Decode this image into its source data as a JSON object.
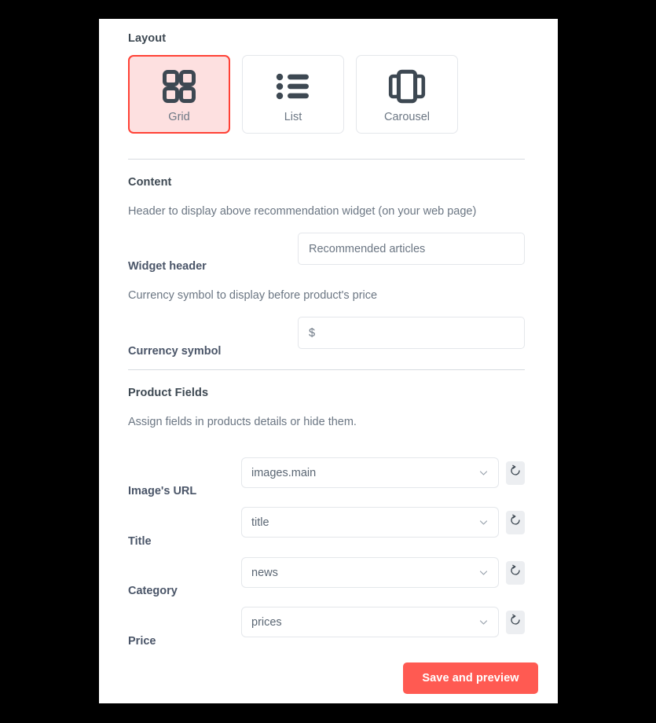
{
  "layout": {
    "section_title": "Layout",
    "options": [
      {
        "label": "Grid",
        "icon": "grid-icon",
        "selected": true
      },
      {
        "label": "List",
        "icon": "list-icon",
        "selected": false
      },
      {
        "label": "Carousel",
        "icon": "carousel-icon",
        "selected": false
      }
    ]
  },
  "content": {
    "section_title": "Content",
    "widget_header_help": "Header to display above recommendation widget (on your web page)",
    "widget_header_label": "Widget header",
    "widget_header_value": "Recommended articles",
    "widget_header_placeholder": "Recommended articles",
    "currency_help": "Currency symbol to display before product's price",
    "currency_label": "Currency symbol",
    "currency_value": "$",
    "currency_placeholder": "$"
  },
  "product_fields": {
    "section_title": "Product Fields",
    "description": "Assign fields in products details or hide them.",
    "rows": [
      {
        "label": "Image's URL",
        "value": "images.main",
        "reset_icon": "refresh-icon",
        "chevron_icon": "chevron-down-icon"
      },
      {
        "label": "Title",
        "value": "title",
        "reset_icon": "refresh-icon",
        "chevron_icon": "chevron-down-icon"
      },
      {
        "label": "Category",
        "value": "news",
        "reset_icon": "refresh-icon",
        "chevron_icon": "chevron-down-icon"
      },
      {
        "label": "Price",
        "value": "prices",
        "reset_icon": "refresh-icon",
        "chevron_icon": "chevron-down-icon"
      }
    ]
  },
  "footer": {
    "save_label": "Save and preview"
  },
  "colors": {
    "accent": "#ff5a52",
    "selected_border": "#ff4136",
    "selected_fill": "#fde0e0",
    "icon_dark": "#3d4852",
    "text_muted": "#6b7683",
    "border": "#e4e7eb",
    "divider": "#d7dbe0",
    "page_background": "#000000",
    "panel_background": "#ffffff"
  }
}
